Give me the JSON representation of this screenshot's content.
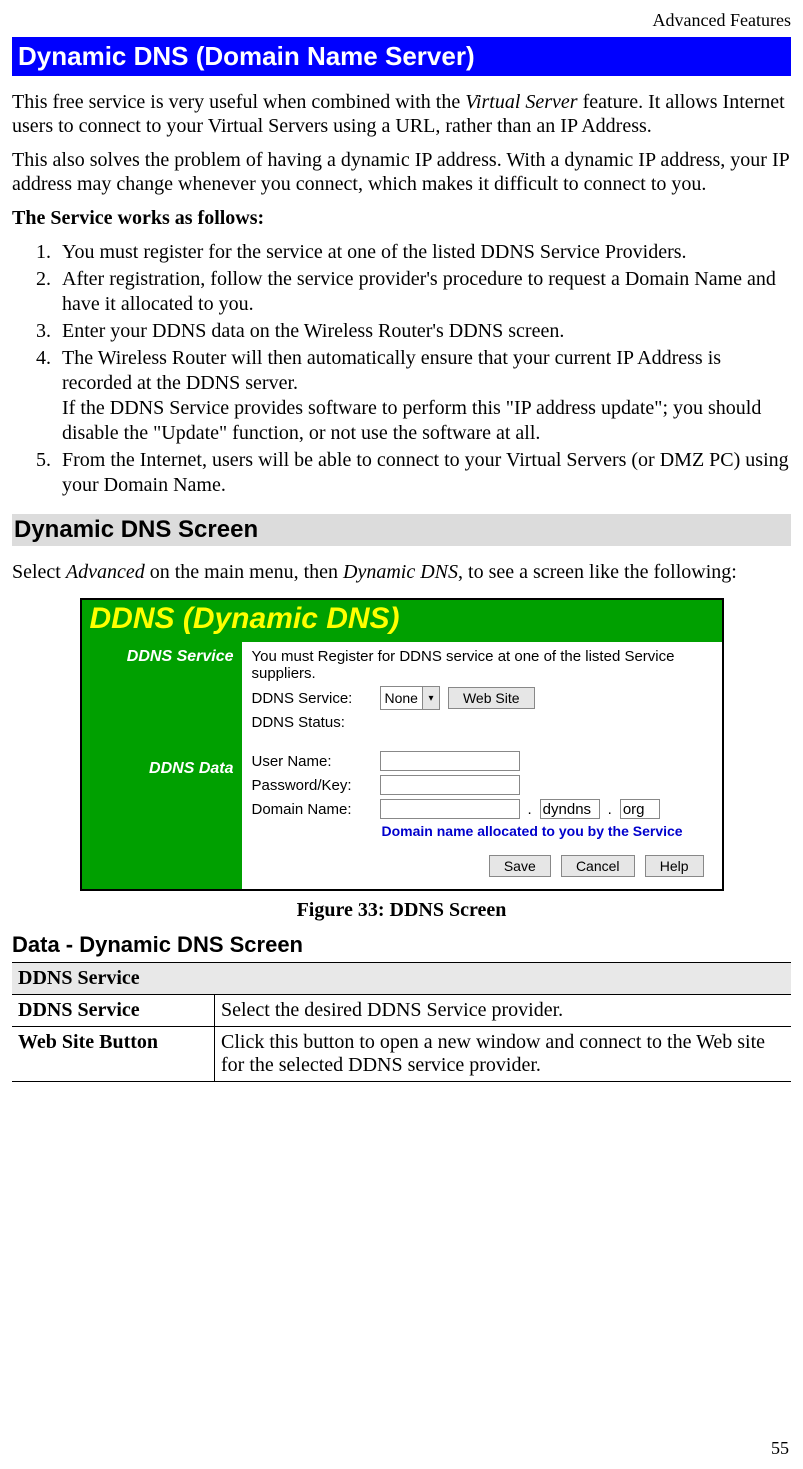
{
  "header": {
    "section_label": "Advanced Features"
  },
  "title": "Dynamic DNS (Domain Name Server)",
  "intro": {
    "p1_a": "This free service is very useful when combined with the ",
    "p1_i": "Virtual Server",
    "p1_b": " feature. It allows Internet users to connect to your Virtual Servers using a URL, rather than an IP Address.",
    "p2": "This also solves the problem of having a dynamic IP address. With a dynamic IP address, your IP address may change whenever you connect, which makes it difficult to connect to you.",
    "works_label": "The Service works as follows:"
  },
  "steps": [
    "You must register for the service at one of the listed DDNS Service Providers.",
    "After registration, follow the service provider's procedure to request a Domain Name and have it allocated to you.",
    "Enter your DDNS data on the Wireless Router's DDNS screen.",
    "The Wireless Router will then automatically ensure that your current IP Address is recorded at the DDNS server.\nIf the DDNS Service provides software to perform this \"IP address update\"; you should disable the \"Update\" function, or not use the software at all.",
    "From the Internet, users will be able to connect to your Virtual Servers (or DMZ PC) using your Domain Name."
  ],
  "h2": "Dynamic DNS Screen",
  "select_line": {
    "a": "Select ",
    "i1": "Advanced",
    "b": " on the main menu, then ",
    "i2": "Dynamic DNS",
    "c": ", to see a screen like the following:"
  },
  "ui": {
    "title": "DDNS (Dynamic DNS)",
    "left": {
      "service": "DDNS Service",
      "data": "DDNS Data"
    },
    "right": {
      "note": "You must Register for DDNS service at one of the listed Service suppliers.",
      "ddns_service_label": "DDNS Service:",
      "ddns_service_value": "None",
      "website_btn": "Web Site",
      "ddns_status_label": "DDNS Status:",
      "username_label": "User Name:",
      "password_label": "Password/Key:",
      "domain_label": "Domain Name:",
      "domain_mid": "dyndns",
      "domain_tld": "org",
      "hint": "Domain name allocated to you by the Service"
    },
    "footer": {
      "save": "Save",
      "cancel": "Cancel",
      "help": "Help"
    }
  },
  "figure_caption": "Figure 33: DDNS Screen",
  "h3": "Data - Dynamic DNS Screen",
  "table": {
    "section": "DDNS Service",
    "rows": [
      {
        "k": "DDNS Service",
        "v": "Select the desired DDNS Service provider."
      },
      {
        "k": "Web Site Button",
        "v": "Click this button to open a new window and connect to the Web site for the selected DDNS service provider."
      }
    ]
  },
  "page_number": "55"
}
